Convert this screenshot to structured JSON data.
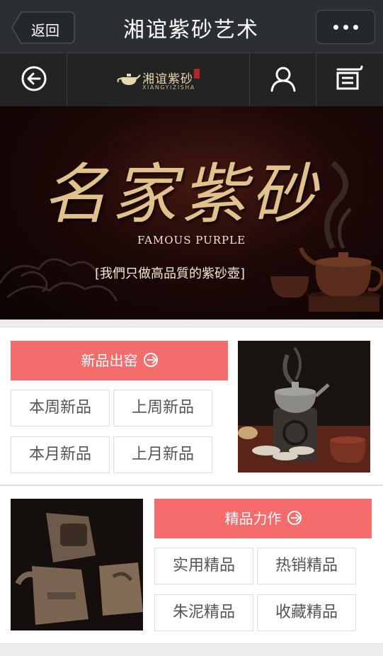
{
  "titlebar": {
    "back_label": "返回",
    "title": "湘谊紫砂艺术"
  },
  "header": {
    "logo_text": "湘谊紫砂",
    "logo_sub": "XIANGYIZISHA"
  },
  "banner": {
    "title": "名家紫砂",
    "subtitle_en": "FAMOUS PURPLE",
    "tagline": "[我們只做高品質的紫砂壺]"
  },
  "sections": [
    {
      "header": "新品出窑",
      "items": [
        "本周新品",
        "上周新品",
        "本月新品",
        "上月新品"
      ]
    },
    {
      "header": "精品力作",
      "items": [
        "实用精品",
        "热销精品",
        "朱泥精品",
        "收藏精品"
      ]
    }
  ],
  "colors": {
    "accent": "#f46c6c",
    "titlebar": "#2b2f33",
    "header": "#232323"
  }
}
